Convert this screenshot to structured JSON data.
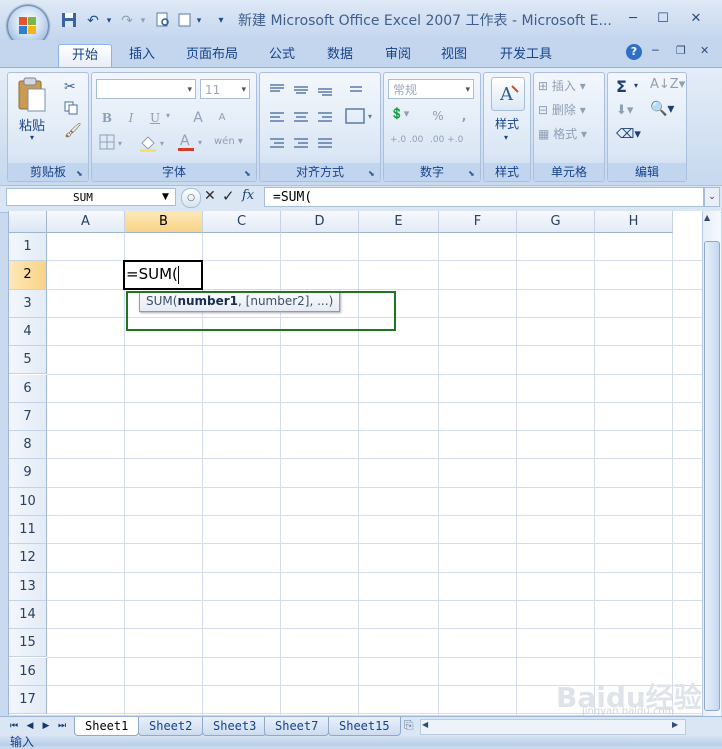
{
  "window": {
    "title": "新建 Microsoft Office Excel 2007 工作表 - Microsoft E...",
    "minimize": "─",
    "maximize": "☐",
    "close": "✕"
  },
  "qat": {
    "save": "💾",
    "undo": "↶",
    "redo": "↷",
    "more": "▾"
  },
  "ribbon_tabs": [
    {
      "label": "开始",
      "active": true
    },
    {
      "label": "插入"
    },
    {
      "label": "页面布局"
    },
    {
      "label": "公式"
    },
    {
      "label": "数据"
    },
    {
      "label": "审阅"
    },
    {
      "label": "视图"
    },
    {
      "label": "开发工具"
    }
  ],
  "ribbon_right": {
    "help": "?",
    "min": "─",
    "restore": "❐",
    "close": "✕"
  },
  "groups": {
    "clipboard": {
      "label": "剪贴板",
      "paste": "粘贴"
    },
    "font": {
      "label": "字体",
      "font_name": "",
      "font_size": "11",
      "bold": "B",
      "italic": "I",
      "underline": "U",
      "grow": "A",
      "shrink": "A",
      "wen": "wén"
    },
    "alignment": {
      "label": "对齐方式"
    },
    "number": {
      "label": "数字",
      "format": "常规",
      "percent": "%",
      "comma": ",",
      "inc": "+.0 .00",
      "dec": ".00 +.0"
    },
    "styles": {
      "label": "样式",
      "button": "样式"
    },
    "cells": {
      "label": "单元格",
      "insert": "插入",
      "delete": "删除",
      "format": "格式"
    },
    "editing": {
      "label": "编辑",
      "sum": "Σ"
    }
  },
  "formula_bar": {
    "name_box": "SUM",
    "fx": "fx",
    "formula": "=SUM("
  },
  "columns": [
    "A",
    "B",
    "C",
    "D",
    "E",
    "F",
    "G",
    "H"
  ],
  "rows": [
    "1",
    "2",
    "3",
    "4",
    "5",
    "6",
    "7",
    "8",
    "9",
    "10",
    "11",
    "12",
    "13",
    "14",
    "15",
    "16",
    "17"
  ],
  "active_cell": {
    "ref": "B2",
    "content": "=SUM("
  },
  "tooltip": {
    "prefix": "SUM(",
    "bold_arg": "number1",
    "rest": ", [number2], ...)"
  },
  "sheets": [
    {
      "name": "Sheet1",
      "active": true
    },
    {
      "name": "Sheet2"
    },
    {
      "name": "Sheet3"
    },
    {
      "name": "Sheet7"
    },
    {
      "name": "Sheet15"
    }
  ],
  "status": {
    "mode": "输入"
  },
  "watermark": {
    "text": "Baidu经验",
    "url": "jingyan.baidu.com"
  },
  "colors": {
    "accent": "#15428b",
    "selection_header": "#f9d486",
    "highlight_box": "#207520"
  }
}
